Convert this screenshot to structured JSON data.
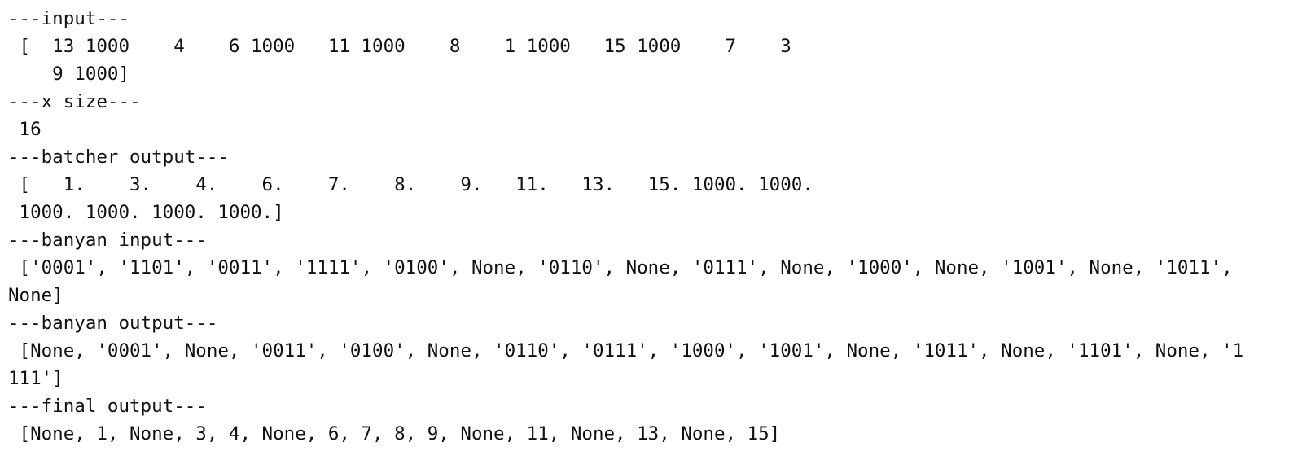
{
  "lines": [
    "---input---",
    " [  13 1000    4    6 1000   11 1000    8    1 1000   15 1000    7    3",
    "    9 1000]",
    "---x size---",
    " 16",
    "---batcher output---",
    " [   1.    3.    4.    6.    7.    8.    9.   11.   13.   15. 1000. 1000.",
    " 1000. 1000. 1000. 1000.]",
    "---banyan input---",
    " ['0001', '1101', '0011', '1111', '0100', None, '0110', None, '0111', None, '1000', None, '1001', None, '1011',",
    "None]",
    "---banyan output---",
    " [None, '0001', None, '0011', '0100', None, '0110', '0111', '1000', '1001', None, '1011', None, '1101', None, '1",
    "111']",
    "---final output---",
    " [None, 1, None, 3, 4, None, 6, 7, 8, 9, None, 11, None, 13, None, 15]"
  ]
}
